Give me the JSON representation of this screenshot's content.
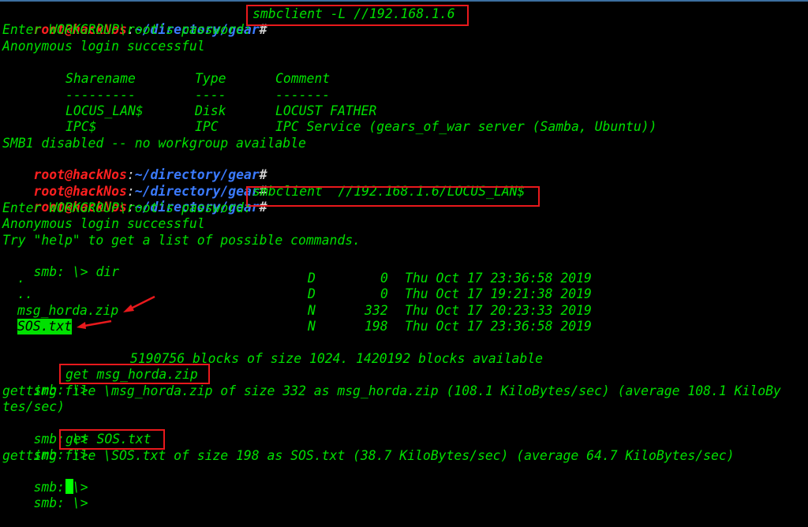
{
  "prompt": {
    "user_host": "root@hackNos",
    "colon": ":",
    "path": "~/directory/gear",
    "symbol": "#"
  },
  "commands": {
    "list_shares": "smbclient -L //192.168.1.6",
    "connect_share": "smbclient  //192.168.1.6/LOCUS_LAN$",
    "get_zip": "get msg_horda.zip",
    "get_sos": "get SOS.txt",
    "dir": "dir"
  },
  "output": {
    "password_prompt": "Enter WORKGROUP\\root's password:",
    "anon_login": "Anonymous login successful",
    "smb1_disabled": "SMB1 disabled -- no workgroup available",
    "try_help": "Try \"help\" to get a list of possible commands.",
    "smb_prompt": "smb: \\>",
    "blocks_info": "5190756 blocks of size 1024. 1420192 blocks available",
    "getting_zip_1": "getting file \\msg_horda.zip of size 332 as msg_horda.zip (108.1 KiloBytes/sec) (average 108.1 KiloBy",
    "getting_zip_2": "tes/sec)",
    "getting_sos": "getting file \\SOS.txt of size 198 as SOS.txt (38.7 KiloBytes/sec) (average 64.7 KiloBytes/sec)"
  },
  "shares_table": {
    "headers": [
      "Sharename",
      "Type",
      "Comment"
    ],
    "separators": [
      "---------",
      "----",
      "-------"
    ],
    "rows": [
      [
        "LOCUS_LAN$",
        "Disk",
        "LOCUST FATHER"
      ],
      [
        "IPC$",
        "IPC",
        "IPC Service (gears_of_war server (Samba, Ubuntu))"
      ]
    ]
  },
  "dir_listing": [
    {
      "name": ".",
      "attr": "D",
      "size": "0",
      "date": "Thu Oct 17 23:36:58 2019"
    },
    {
      "name": "..",
      "attr": "D",
      "size": "0",
      "date": "Thu Oct 17 19:21:38 2019"
    },
    {
      "name": "msg_horda.zip",
      "attr": "N",
      "size": "332",
      "date": "Thu Oct 17 20:23:33 2019"
    },
    {
      "name": "SOS.txt",
      "attr": "N",
      "size": "198",
      "date": "Thu Oct 17 23:36:58 2019"
    }
  ],
  "colors": {
    "text_green": "#00e000",
    "prompt_user": "#ff2020",
    "prompt_path": "#3b7bff",
    "highlight_box": "#e8191c",
    "background": "#000000"
  }
}
